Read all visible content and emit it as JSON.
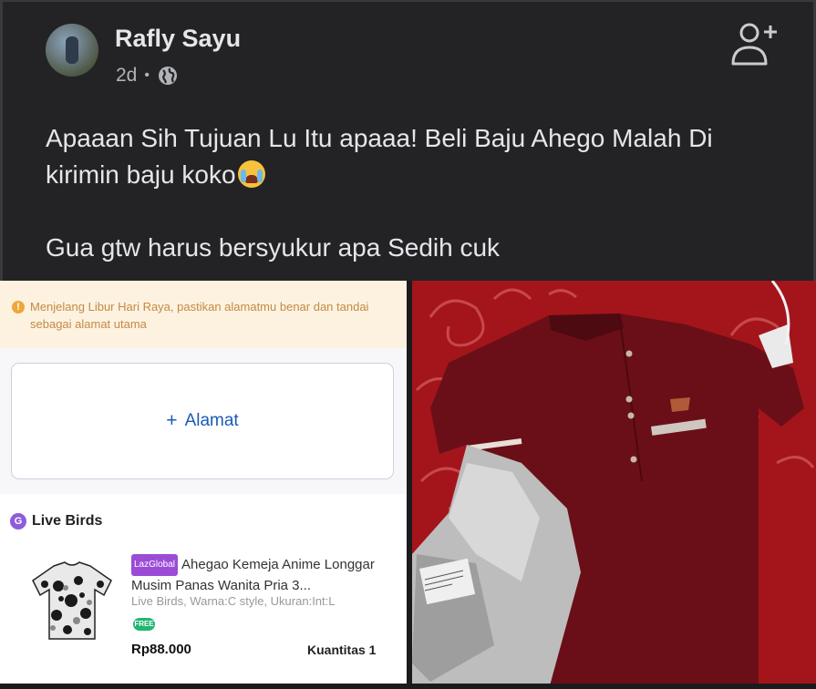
{
  "post": {
    "author": "Rafly Sayu",
    "time": "2d",
    "separator": "•",
    "text_line1": "Apaaan Sih Tujuan Lu Itu apaaa! Beli Baju Ahego Malah Di",
    "text_line2": "kirimin baju koko",
    "text_line3": "Gua gtw harus bersyukur apa Sedih cuk",
    "emoji": "crying-face-emoji",
    "icons": [
      "globe-icon",
      "add-friend-icon"
    ]
  },
  "shop": {
    "notice": "Menjelang Libur Hari Raya, pastikan alamatmu benar dan tandai sebagai alamat utama",
    "notice_icon": "!",
    "add_address_plus": "+",
    "add_address": "Alamat",
    "seller_name": "Live Birds",
    "product_badge": "LazGlobal",
    "product_title": "Ahegao Kemeja Anime Longgar Musim Panas Wanita Pria 3...",
    "product_variant": "Live Birds, Warna:C style, Ukuran:Int:L",
    "free_badge": "FREE",
    "price": "Rp88.000",
    "quantity": "Kuantitas 1"
  },
  "colors": {
    "background": "#232325",
    "text": "#e4e6eb",
    "link_blue": "#1a5bb8",
    "shirt_maroon": "#6e1018",
    "sheet_red": "#a8141a"
  }
}
